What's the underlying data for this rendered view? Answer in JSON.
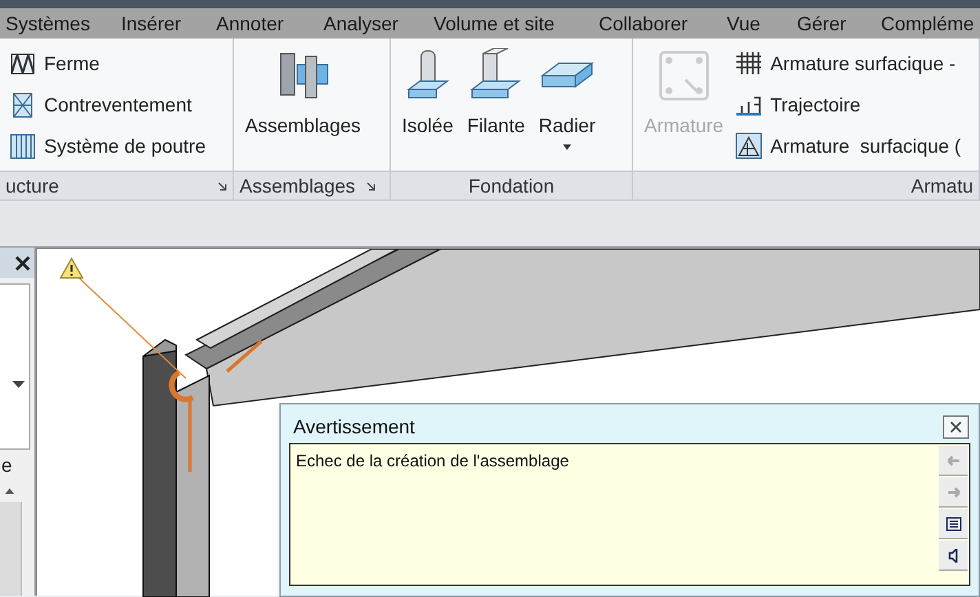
{
  "tabs": [
    {
      "label": "Systèmes"
    },
    {
      "label": "Insérer"
    },
    {
      "label": "Annoter"
    },
    {
      "label": "Analyser"
    },
    {
      "label": "Volume et site"
    },
    {
      "label": "Collaborer"
    },
    {
      "label": "Vue"
    },
    {
      "label": "Gérer"
    },
    {
      "label": "Compléme"
    }
  ],
  "ribbon": {
    "panels": [
      {
        "title": "ucture",
        "launcher": true,
        "buttons": [
          {
            "kind": "small",
            "label": "Ferme",
            "disabled": false
          },
          {
            "kind": "small",
            "label": "Contreventement",
            "disabled": false
          },
          {
            "kind": "small",
            "label": "Système de poutre",
            "disabled": false
          }
        ]
      },
      {
        "title": "Assemblages",
        "launcher": true,
        "buttons": [
          {
            "kind": "large",
            "label": "Assemblages",
            "disabled": false
          }
        ]
      },
      {
        "title": "Fondation",
        "launcher": false,
        "buttons": [
          {
            "kind": "large",
            "label": "Isolée",
            "disabled": false
          },
          {
            "kind": "large",
            "label": "Filante",
            "disabled": false
          },
          {
            "kind": "split",
            "label": "Radier",
            "disabled": false
          }
        ]
      },
      {
        "title": "Armatu",
        "launcher": false,
        "buttons": [
          {
            "kind": "large",
            "label": "Armature",
            "disabled": true
          },
          {
            "kind": "small",
            "label": "Armature surfacique -",
            "disabled": false
          },
          {
            "kind": "small",
            "label": "Trajectoire",
            "disabled": false
          },
          {
            "kind": "small",
            "label": "Armature  surfacique (",
            "disabled": false
          }
        ]
      }
    ]
  },
  "properties_panel": {
    "text": "e"
  },
  "warning_dialog": {
    "title": "Avertissement",
    "message": "Echec de la création de l'assemblage",
    "side_buttons": [
      {
        "disabled": true
      },
      {
        "disabled": true
      },
      {
        "disabled": false
      },
      {
        "disabled": false
      }
    ]
  }
}
